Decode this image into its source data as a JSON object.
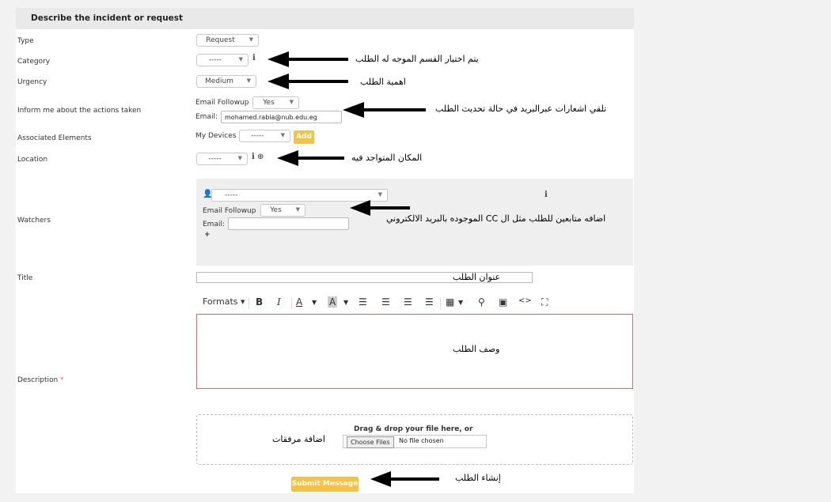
{
  "form": {
    "section_title": "Describe the incident or request",
    "type": {
      "label": "Type",
      "value": "Request"
    },
    "category": {
      "label": "Category",
      "value": "-----"
    },
    "urgency": {
      "label": "Urgency",
      "value": "Medium"
    },
    "inform": {
      "label": "Inform me about the actions taken",
      "followup_label": "Email Followup",
      "followup_value": "Yes",
      "email_label": "Email:",
      "email_value": "mohamed.rabia@nub.edu.eg"
    },
    "associated": {
      "label": "Associated Elements",
      "devices_label": "My Devices",
      "devices_value": "-----",
      "add_label": "Add"
    },
    "location": {
      "label": "Location",
      "value": "-----"
    },
    "watchers": {
      "label": "Watchers",
      "user_value": "-----",
      "followup_label": "Email Followup",
      "followup_value": "Yes",
      "email_label": "Email:",
      "add_symbol": "+"
    },
    "title": {
      "label": "Title"
    },
    "description": {
      "label": "Description",
      "required_mark": "*"
    },
    "toolbar": {
      "formats_label": "Formats"
    },
    "upload": {
      "drop_text": "Drag & drop your file here, or",
      "choose_label": "Choose Files",
      "no_file_label": "No file chosen"
    },
    "submit_label": "Submit Message"
  },
  "annotations": {
    "category": "يتم اختيار القسم الموجه له الطلب",
    "urgency": "اهمية الطلب",
    "inform": "تلقي اشعارات عبرالبريد في حالة تحديث الطلب",
    "location": "المكان المتواجد فيه",
    "watchers": "اضافه متابعين للطلب مثل ال CC   الموجوده بالبريد الالكتروني",
    "title": "عنوان الطلب",
    "description": "وصف الطلب",
    "attachments": "اضافة مرفقات",
    "submit": "إنشاء الطلب"
  },
  "colors": {
    "accent": "#f6c244",
    "required": "#e06666",
    "header_bg": "#e9e9e9"
  }
}
